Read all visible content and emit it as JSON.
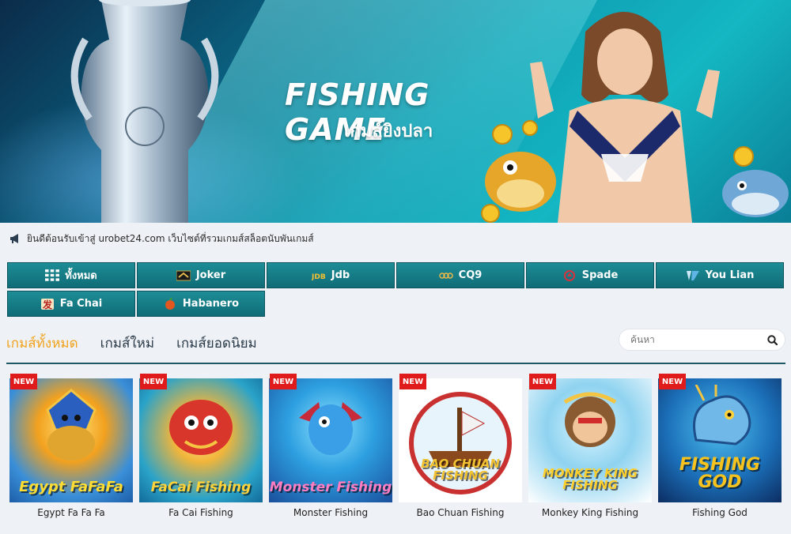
{
  "banner": {
    "title": "FISHING GAME",
    "subtitle": "เกมส์ยิงปลา"
  },
  "notice": {
    "text": "ยินดีต้อนรับเข้าสู่ urobet24.com เว็บไซต์ที่รวมเกมส์สล็อตนับพันเกมส์"
  },
  "providers": [
    {
      "label": "ทั้งหมด",
      "icon": "grid-icon"
    },
    {
      "label": "Joker",
      "icon": "joker-logo-icon"
    },
    {
      "label": "Jdb",
      "icon": "jdb-logo-icon"
    },
    {
      "label": "CQ9",
      "icon": "cq9-logo-icon"
    },
    {
      "label": "Spade",
      "icon": "spade-logo-icon"
    },
    {
      "label": "You Lian",
      "icon": "youlian-logo-icon"
    },
    {
      "label": "Fa Chai",
      "icon": "fachai-logo-icon"
    },
    {
      "label": "Habanero",
      "icon": "habanero-logo-icon"
    }
  ],
  "tabs": [
    {
      "label": "เกมส์ทั้งหมด",
      "active": true
    },
    {
      "label": "เกมส์ใหม่",
      "active": false
    },
    {
      "label": "เกมส์ยอดนิยม",
      "active": false
    }
  ],
  "search": {
    "placeholder": "ค้นหา"
  },
  "games": [
    {
      "name": "Egypt Fa Fa Fa",
      "badge": "NEW",
      "art_title": "Egypt FaFaFa"
    },
    {
      "name": "Fa Cai Fishing",
      "badge": "NEW",
      "art_title": "FaCai Fishing"
    },
    {
      "name": "Monster Fishing",
      "badge": "NEW",
      "art_title": "Monster Fishing"
    },
    {
      "name": "Bao Chuan Fishing",
      "badge": "NEW",
      "art_title": "BAO CHUAN FISHING"
    },
    {
      "name": "Monkey King Fishing",
      "badge": "NEW",
      "art_title": "MONKEY KING FISHING"
    },
    {
      "name": "Fishing God",
      "badge": "NEW",
      "art_title": "FISHING GOD"
    }
  ],
  "colors": {
    "accent": "#f2a21c",
    "provider_bg": "#0f6c76",
    "badge": "#e01b1b"
  }
}
